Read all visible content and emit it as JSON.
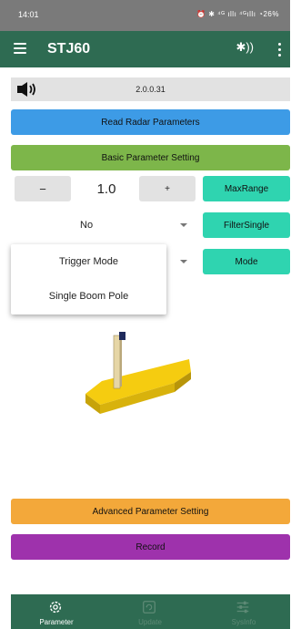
{
  "status_bar": {
    "time": "14:01",
    "indicators": "⏰ ✱ ⁴ᴳ ıllı ⁴ᴳıllı ◔26%"
  },
  "app_bar": {
    "title": "STJ60",
    "menu_icon": "hamburger-menu-icon",
    "bluetooth_icon": "bluetooth-connected-icon",
    "bluetooth_glyph": "✱))",
    "more_icon": "more-vertical-icon"
  },
  "device_row": {
    "speaker_icon": "speaker-volume-icon",
    "version": "2.0.0.31"
  },
  "buttons": {
    "read_radar": "Read Radar Parameters",
    "basic_setting": "Basic Parameter Setting",
    "advanced_setting": "Advanced Parameter Setting",
    "record": "Record"
  },
  "range": {
    "minus_label": "−",
    "value": "1.0",
    "plus_label": "+",
    "action_label": "MaxRange"
  },
  "filter": {
    "selected": "No",
    "action_label": "FilterSingle"
  },
  "mode": {
    "selected": "",
    "action_label": "Mode"
  },
  "popup_menu": {
    "items": [
      "Trigger Mode",
      "Single Boom Pole"
    ]
  },
  "bottom_nav": {
    "items": [
      {
        "label": "Parameter",
        "icon": "gear-icon",
        "active": true
      },
      {
        "label": "Update",
        "icon": "update-icon",
        "active": false
      },
      {
        "label": "SysInfo",
        "icon": "sliders-icon",
        "active": false
      }
    ]
  },
  "colors": {
    "app_bar": "#2e6b52",
    "read_button": "#3d9be6",
    "basic_button": "#7db64a",
    "action_buttons": "#2fd4b0",
    "advanced_button": "#f3a83a",
    "record_button": "#9e32ac",
    "barrier_base": "#f5cc10"
  }
}
